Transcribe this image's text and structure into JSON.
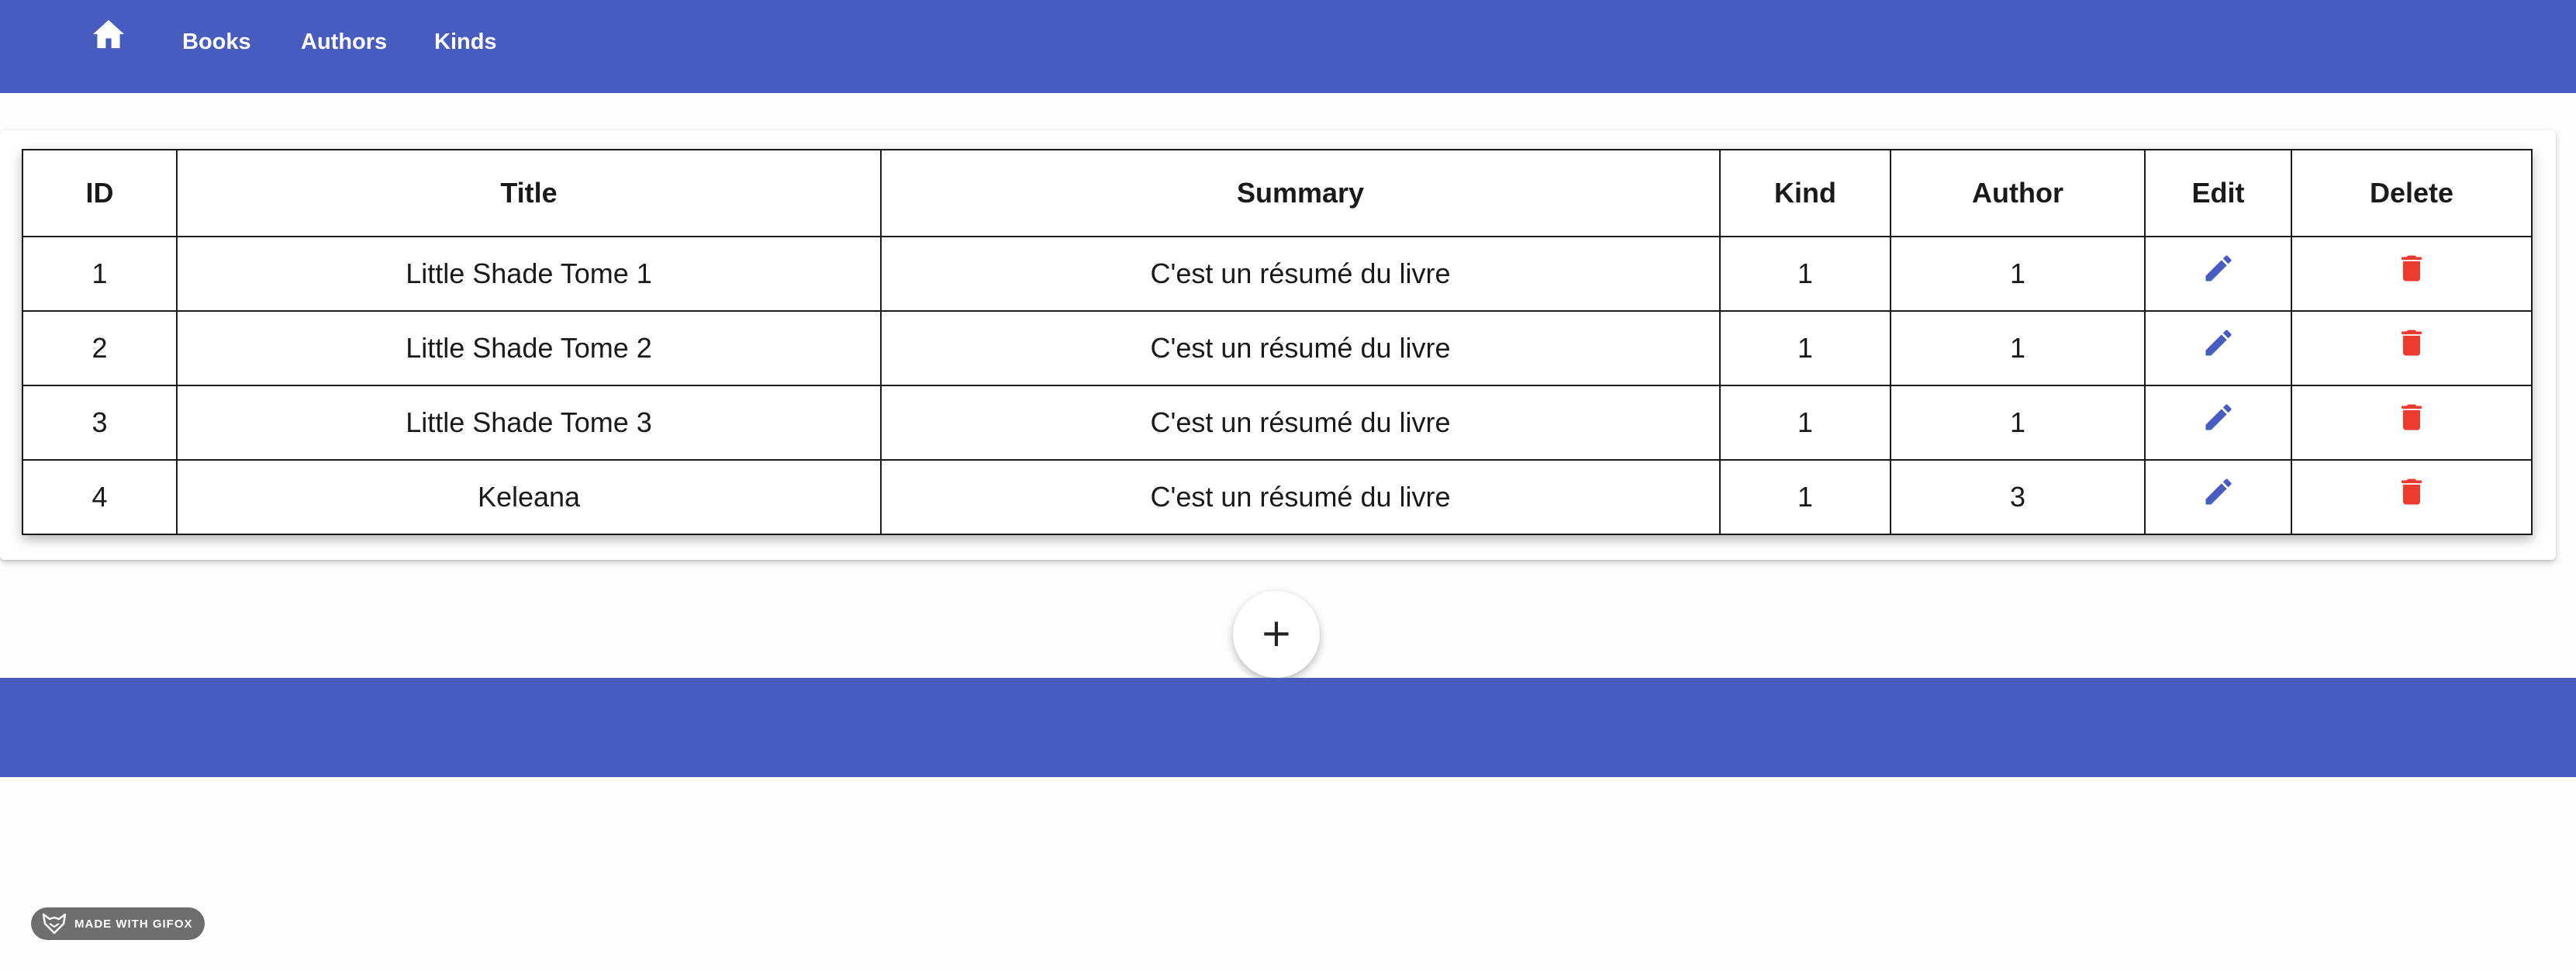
{
  "nav": {
    "home_icon": "home-icon",
    "links": [
      "Books",
      "Authors",
      "Kinds"
    ]
  },
  "table": {
    "headers": {
      "id": "ID",
      "title": "Title",
      "summary": "Summary",
      "kind": "Kind",
      "author": "Author",
      "edit": "Edit",
      "delete": "Delete"
    },
    "rows": [
      {
        "id": "1",
        "title": "Little Shade Tome 1",
        "summary": "C'est un résumé du livre",
        "kind": "1",
        "author": "1"
      },
      {
        "id": "2",
        "title": "Little Shade Tome 2",
        "summary": "C'est un résumé du livre",
        "kind": "1",
        "author": "1"
      },
      {
        "id": "3",
        "title": "Little Shade Tome 3",
        "summary": "C'est un résumé du livre",
        "kind": "1",
        "author": "1"
      },
      {
        "id": "4",
        "title": "Keleana",
        "summary": "C'est un résumé du livre",
        "kind": "1",
        "author": "3"
      }
    ],
    "edit_icon": "pencil-icon",
    "delete_icon": "trash-icon"
  },
  "fab": {
    "label": "+"
  },
  "watermark": {
    "text": "MADE WITH GIFOX"
  },
  "colors": {
    "primary": "#485bbf",
    "edit": "#485bbf",
    "delete": "#ef3b2f"
  }
}
